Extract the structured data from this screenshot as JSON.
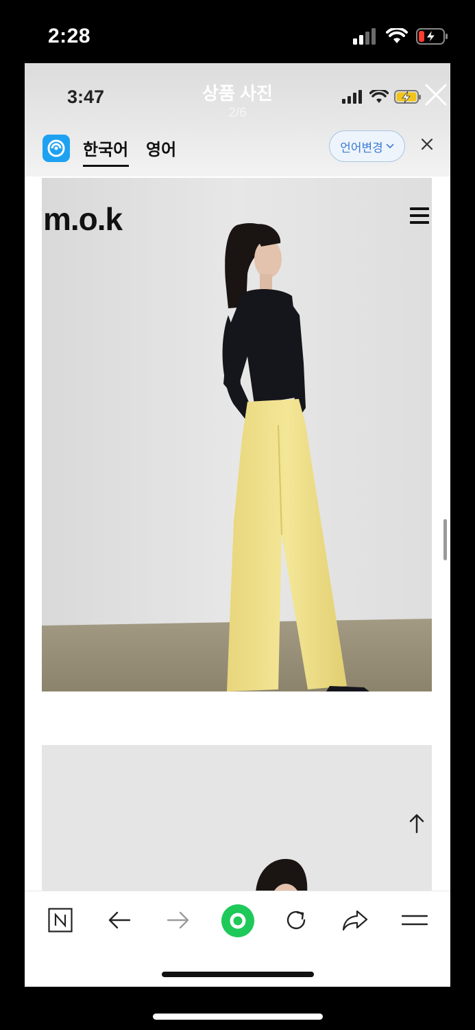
{
  "outer_status": {
    "time": "2:28"
  },
  "viewer": {
    "inner_time": "3:47",
    "title": "상품 사진",
    "counter": "2/6"
  },
  "translate_bar": {
    "tabs": [
      "한국어",
      "영어"
    ],
    "change_button": "언어변경"
  },
  "page": {
    "brand": "m.o.k"
  },
  "colors": {
    "accent_blue": "#1ea1f1",
    "green_button": "#1ec95a",
    "pants_yellow": "#f0e28f",
    "shirt_black": "#15151c"
  }
}
